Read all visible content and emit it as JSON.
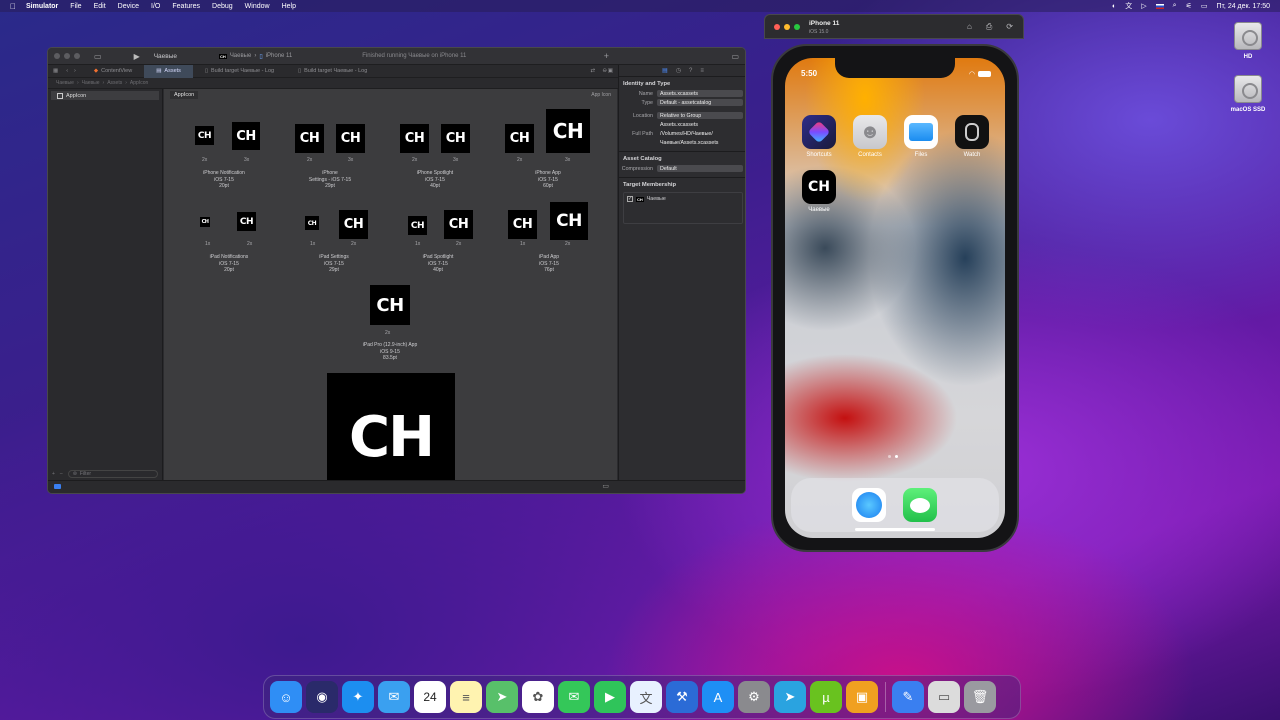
{
  "menubar": {
    "app_name": "Simulator",
    "items": [
      "File",
      "Edit",
      "Device",
      "I/O",
      "Features",
      "Debug",
      "Window",
      "Help"
    ],
    "datetime": "Пт, 24 дек.  17:50"
  },
  "xcode": {
    "scheme": "Чаевые",
    "destination_app": "Чаевые",
    "destination_device": "iPhone 11",
    "status": "Finished running Чаевые on iPhone 11",
    "tabs": [
      "ContentView",
      "Assets",
      "Build target Чаевые - Log",
      "Build target Чаевые - Log"
    ],
    "jump_bar": [
      "Чаевые",
      "Чаевые",
      "Assets",
      "AppIcon"
    ],
    "navigator": {
      "items": [
        "AppIcon"
      ],
      "filter_placeholder": "Filter"
    },
    "editor": {
      "set_name": "AppIcon",
      "set_type": "App Icon",
      "tile_text": "CH",
      "groups": [
        {
          "name": "iPhone Notification",
          "os": "iOS 7-15",
          "size": "20pt",
          "scales": [
            "2x",
            "3x"
          ]
        },
        {
          "name": "iPhone",
          "os": "Settings - iOS 7-15",
          "size": "29pt",
          "scales": [
            "2x",
            "3x"
          ]
        },
        {
          "name": "iPhone Spotlight",
          "os": "iOS 7-15",
          "size": "40pt",
          "scales": [
            "2x",
            "3x"
          ]
        },
        {
          "name": "iPhone App",
          "os": "iOS 7-15",
          "size": "60pt",
          "scales": [
            "2x",
            "3x"
          ]
        },
        {
          "name": "iPad Notifications",
          "os": "iOS 7-15",
          "size": "20pt",
          "scales": [
            "1x",
            "2x"
          ]
        },
        {
          "name": "iPad Settings",
          "os": "iOS 7-15",
          "size": "29pt",
          "scales": [
            "1x",
            "2x"
          ]
        },
        {
          "name": "iPad Spotlight",
          "os": "iOS 7-15",
          "size": "40pt",
          "scales": [
            "1x",
            "2x"
          ]
        },
        {
          "name": "iPad App",
          "os": "iOS 7-15",
          "size": "76pt",
          "scales": [
            "1x",
            "2x"
          ]
        },
        {
          "name": "iPad Pro (12.9-inch) App",
          "os": "iOS 9-15",
          "size": "83.5pt",
          "scales": [
            "2x"
          ]
        }
      ]
    },
    "inspector": {
      "identity_title": "Identity and Type",
      "name_label": "Name",
      "name_value": "Assets.xcassets",
      "type_label": "Type",
      "type_value": "Default - assetcatalog",
      "location_label": "Location",
      "location_value": "Relative to Group",
      "location_file": "Assets.xcassets",
      "fullpath_label": "Full Path",
      "fullpath_value_1": "/Volumes/HD/Чаевые/",
      "fullpath_value_2": "Чаевые/Assets.xcassets",
      "catalog_title": "Asset Catalog",
      "compression_label": "Compression",
      "compression_value": "Default",
      "membership_title": "Target Membership",
      "membership_target": "Чаевые"
    }
  },
  "simulator": {
    "device": "iPhone 11",
    "os": "iOS 15.0",
    "time": "5:50",
    "apps": [
      {
        "name": "Shortcuts",
        "color": "#3a3aff"
      },
      {
        "name": "Contacts",
        "color": "#d8d8dc"
      },
      {
        "name": "Files",
        "color": "#ffffff"
      },
      {
        "name": "Watch",
        "color": "#111111"
      },
      {
        "name": "Чаевые",
        "color": "#000000"
      }
    ],
    "dock_apps": [
      "Safari",
      "Messages"
    ]
  },
  "desktop": {
    "disks": [
      "HD",
      "macOS SSD"
    ]
  },
  "dock": {
    "items": [
      {
        "name": "Finder",
        "color": "#2f8ef5",
        "glyph": "☺"
      },
      {
        "name": "Siri",
        "color": "#2a2a6a",
        "glyph": "◉"
      },
      {
        "name": "Safari",
        "color": "#1c8ef0",
        "glyph": "✦"
      },
      {
        "name": "Mail",
        "color": "#3aa0f0",
        "glyph": "✉"
      },
      {
        "name": "Calendar",
        "color": "#ffffff",
        "glyph": "24"
      },
      {
        "name": "Notes",
        "color": "#fff3b0",
        "glyph": "≡"
      },
      {
        "name": "Maps",
        "color": "#58c06a",
        "glyph": "➤"
      },
      {
        "name": "Photos",
        "color": "#ffffff",
        "glyph": "✿"
      },
      {
        "name": "Messages",
        "color": "#34c759",
        "glyph": "✉"
      },
      {
        "name": "FaceTime",
        "color": "#2fc45a",
        "glyph": "▶"
      },
      {
        "name": "Translate",
        "color": "#e8f1ff",
        "glyph": "文"
      },
      {
        "name": "Xcode",
        "color": "#2b6bd6",
        "glyph": "⚒"
      },
      {
        "name": "App Store",
        "color": "#1e8ff5",
        "glyph": "A"
      },
      {
        "name": "System Preferences",
        "color": "#8a8a8e",
        "glyph": "⚙"
      },
      {
        "name": "Telegram",
        "color": "#2aa3e0",
        "glyph": "➤"
      },
      {
        "name": "uTorrent",
        "color": "#69c21f",
        "glyph": "µ"
      },
      {
        "name": "Parallels",
        "color": "#f0a020",
        "glyph": "▣"
      },
      {
        "name": "Simulator",
        "color": "#3a7ff0",
        "glyph": "✎"
      },
      {
        "name": "Preview",
        "color": "#dcdcdc",
        "glyph": "▭"
      },
      {
        "name": "Trash",
        "color": "#9a9aa0",
        "glyph": "🗑"
      }
    ],
    "calendar_month": "ДЕК."
  }
}
